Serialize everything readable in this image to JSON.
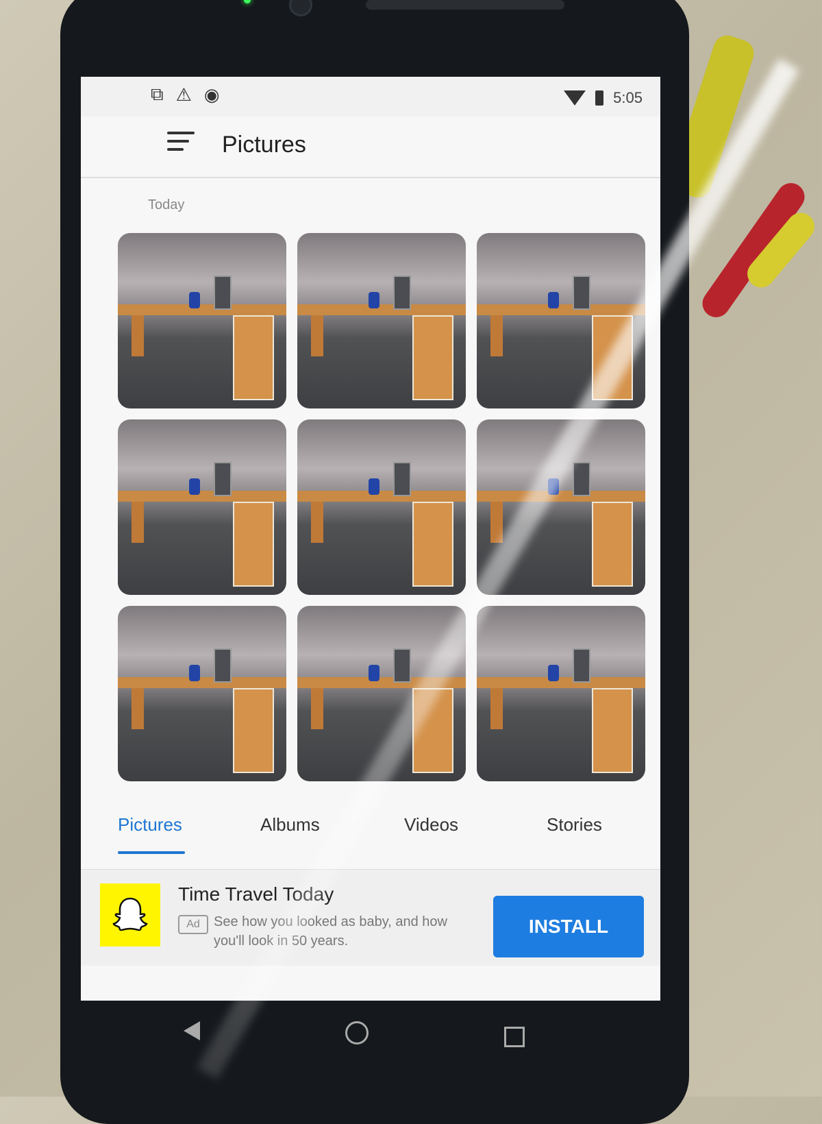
{
  "status_bar": {
    "time": "5:05"
  },
  "app_bar": {
    "title": "Pictures"
  },
  "section": {
    "label": "Today"
  },
  "photos": [
    {
      "alt": "photo-1"
    },
    {
      "alt": "photo-2"
    },
    {
      "alt": "photo-3"
    },
    {
      "alt": "photo-4"
    },
    {
      "alt": "photo-5"
    },
    {
      "alt": "photo-6"
    },
    {
      "alt": "photo-7"
    },
    {
      "alt": "photo-8"
    },
    {
      "alt": "photo-9"
    }
  ],
  "tabs": [
    {
      "label": "Pictures",
      "active": true
    },
    {
      "label": "Albums",
      "active": false
    },
    {
      "label": "Videos",
      "active": false
    },
    {
      "label": "Stories",
      "active": false
    }
  ],
  "ad": {
    "title": "Time Travel Today",
    "badge": "Ad",
    "description": "See how you looked as baby, and how you'll look in 50 years.",
    "button": "INSTALL",
    "logo_color": "#FFF500"
  },
  "colors": {
    "accent": "#1E76D1",
    "install_button": "#1E7DE0"
  }
}
